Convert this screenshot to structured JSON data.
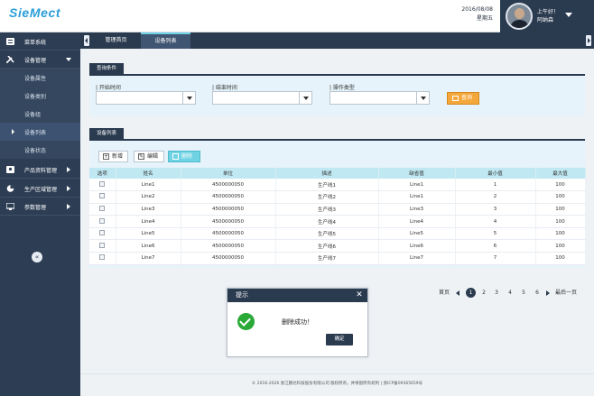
{
  "app": {
    "logo": "SieMect"
  },
  "header": {
    "date": "2016/08/08",
    "weekday": "星期五",
    "greeting": "上午好！",
    "username": "阿纳森"
  },
  "sidebar": {
    "items": [
      {
        "label": "菜单系统",
        "icon": "menu-icon"
      },
      {
        "label": "设备管理",
        "icon": "tools-icon"
      },
      {
        "label": "设备属性"
      },
      {
        "label": "设备类别"
      },
      {
        "label": "设备组"
      },
      {
        "label": "设备列表"
      },
      {
        "label": "设备状态"
      },
      {
        "label": "产品资料管理",
        "icon": "id-card-icon"
      },
      {
        "label": "生产区域管理",
        "icon": "pie-chart-icon"
      },
      {
        "label": "参数管理",
        "icon": "monitor-icon"
      }
    ],
    "collapse": "«"
  },
  "tabs": [
    {
      "label": "管理首页"
    },
    {
      "label": "设备列表"
    }
  ],
  "query": {
    "title": "查询条件",
    "start_label": "| 开始时间",
    "end_label": "| 结束时间",
    "type_label": "| 操作类型",
    "search_button": "查询"
  },
  "list": {
    "title": "设备列表",
    "add": "新增",
    "edit": "编辑",
    "delete": "删除",
    "columns": [
      "选项",
      "姓名",
      "单位",
      "描述",
      "缺省值",
      "最小值",
      "最大值"
    ],
    "rows": [
      {
        "name": "Line1",
        "unit": "4500000050",
        "desc": "生产线1",
        "def": "Line1",
        "min": "1",
        "max": "100"
      },
      {
        "name": "Line2",
        "unit": "4500000050",
        "desc": "生产线2",
        "def": "Line1",
        "min": "2",
        "max": "100"
      },
      {
        "name": "Line3",
        "unit": "4500000050",
        "desc": "生产线3",
        "def": "Line3",
        "min": "3",
        "max": "100"
      },
      {
        "name": "Line4",
        "unit": "4500000050",
        "desc": "生产线4",
        "def": "Line4",
        "min": "4",
        "max": "100"
      },
      {
        "name": "Line5",
        "unit": "4500000050",
        "desc": "生产线5",
        "def": "Line5",
        "min": "5",
        "max": "100"
      },
      {
        "name": "Line6",
        "unit": "4500000050",
        "desc": "生产线6",
        "def": "Line6",
        "min": "6",
        "max": "100"
      },
      {
        "name": "Line7",
        "unit": "4500000050",
        "desc": "生产线7",
        "def": "Line7",
        "min": "7",
        "max": "100"
      }
    ]
  },
  "pager": {
    "first": "首页",
    "last": "最后一页",
    "pages": [
      "1",
      "2",
      "3",
      "4",
      "5",
      "6"
    ],
    "current": "1"
  },
  "dialog": {
    "title": "提示",
    "message": "删除成功！",
    "ok": "确定",
    "close": "✕"
  },
  "footer": {
    "text": "© 2016-2026 浙江鹏达科技股份有限公司 版权所有，并保留所有权利 | 浙ICP备09365659号"
  },
  "colors": {
    "navy": "#2a3a4f",
    "accent": "#6fd0e6",
    "orange": "#f4a73a",
    "success": "#2aa936"
  }
}
